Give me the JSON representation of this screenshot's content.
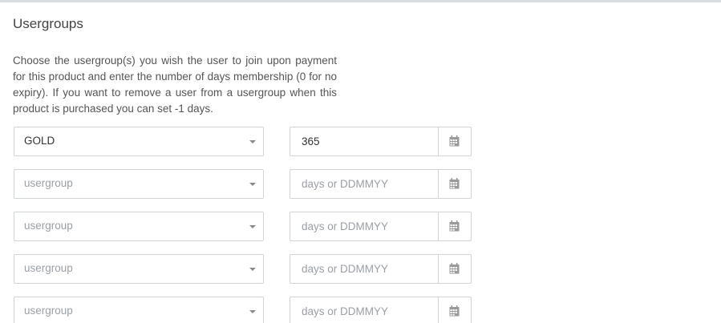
{
  "section": {
    "title": "Usergroups",
    "description": "Choose the usergroup(s) you wish the user to join upon payment for this product and enter the number of days membership (0 for no expiry). If you want to remove a user from a usergroup when this product is purchased you can set -1 days."
  },
  "rows": [
    {
      "usergroup_value": "GOLD",
      "usergroup_placeholder": "usergroup",
      "days_value": "365",
      "days_placeholder": "days or DDMMYY"
    },
    {
      "usergroup_value": "",
      "usergroup_placeholder": "usergroup",
      "days_value": "",
      "days_placeholder": "days or DDMMYY"
    },
    {
      "usergroup_value": "",
      "usergroup_placeholder": "usergroup",
      "days_value": "",
      "days_placeholder": "days or DDMMYY"
    },
    {
      "usergroup_value": "",
      "usergroup_placeholder": "usergroup",
      "days_value": "",
      "days_placeholder": "days or DDMMYY"
    },
    {
      "usergroup_value": "",
      "usergroup_placeholder": "usergroup",
      "days_value": "",
      "days_placeholder": "days or DDMMYY"
    }
  ],
  "icons": {
    "select_caret": "chevron-down-icon",
    "date_picker": "calendar-icon"
  },
  "colors": {
    "border": "#cfd4d9",
    "top_rule": "#d9dde2",
    "text": "#555555",
    "placeholder": "#9aa0a6",
    "icon": "#999999"
  }
}
